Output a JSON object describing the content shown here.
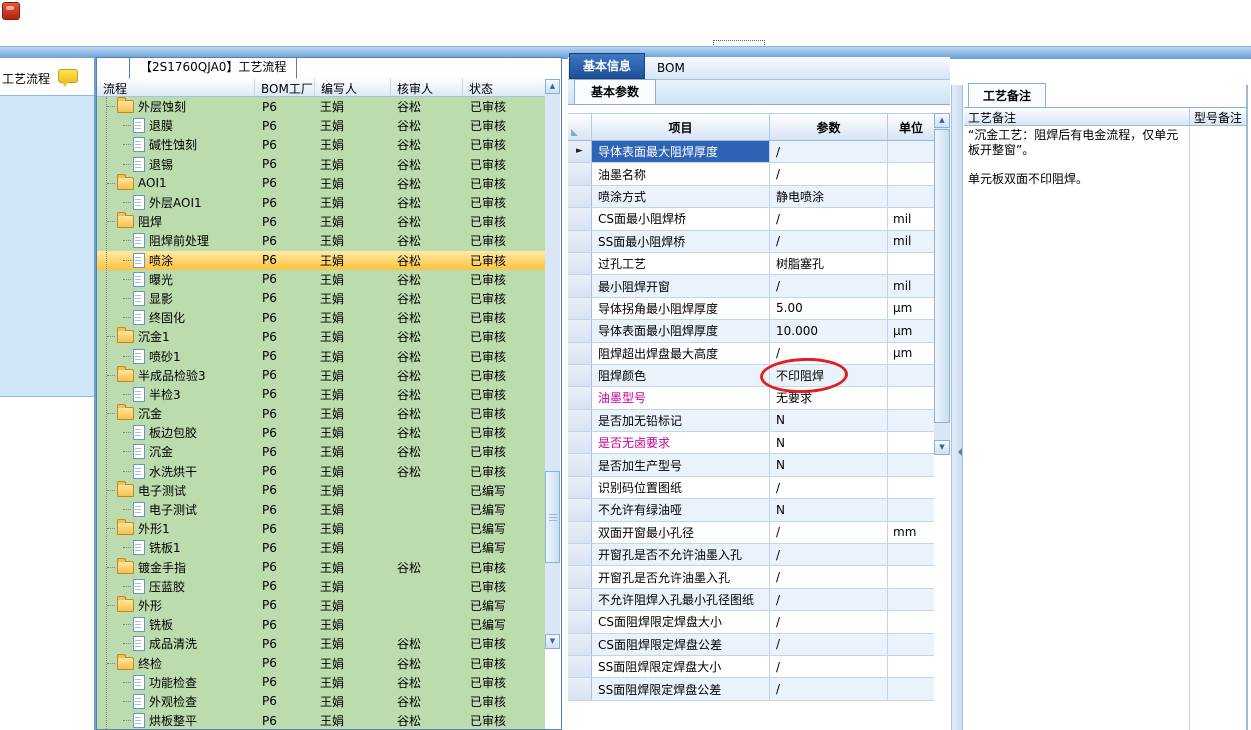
{
  "chrome": {
    "app_icon": "red-app-icon",
    "focus_marker": "dotted-focus-rect"
  },
  "left_panel": {
    "title": "工艺流程"
  },
  "process_window": {
    "title": "【2S1760QJA0】工艺流程",
    "columns": {
      "name": "流程",
      "factory": "BOM工厂",
      "writer": "编写人",
      "reviewer": "核审人",
      "status": "状态"
    },
    "rows": [
      {
        "name": "外层蚀刻",
        "type": "folder",
        "level": 1,
        "factory": "P6",
        "writer": "王娟",
        "reviewer": "谷松",
        "status": "已审核",
        "selected": false
      },
      {
        "name": "退膜",
        "type": "file",
        "level": 2,
        "factory": "P6",
        "writer": "王娟",
        "reviewer": "谷松",
        "status": "已审核",
        "selected": false
      },
      {
        "name": "碱性蚀刻",
        "type": "file",
        "level": 2,
        "factory": "P6",
        "writer": "王娟",
        "reviewer": "谷松",
        "status": "已审核",
        "selected": false
      },
      {
        "name": "退锡",
        "type": "file",
        "level": 2,
        "factory": "P6",
        "writer": "王娟",
        "reviewer": "谷松",
        "status": "已审核",
        "selected": false
      },
      {
        "name": "AOI1",
        "type": "folder",
        "level": 1,
        "factory": "P6",
        "writer": "王娟",
        "reviewer": "谷松",
        "status": "已审核",
        "selected": false
      },
      {
        "name": "外层AOI1",
        "type": "file",
        "level": 2,
        "factory": "P6",
        "writer": "王娟",
        "reviewer": "谷松",
        "status": "已审核",
        "selected": false
      },
      {
        "name": "阻焊",
        "type": "folder",
        "level": 1,
        "factory": "P6",
        "writer": "王娟",
        "reviewer": "谷松",
        "status": "已审核",
        "selected": false
      },
      {
        "name": "阻焊前处理",
        "type": "file",
        "level": 2,
        "factory": "P6",
        "writer": "王娟",
        "reviewer": "谷松",
        "status": "已审核",
        "selected": false
      },
      {
        "name": "喷涂",
        "type": "file",
        "level": 2,
        "factory": "P6",
        "writer": "王娟",
        "reviewer": "谷松",
        "status": "已审核",
        "selected": true
      },
      {
        "name": "曝光",
        "type": "file",
        "level": 2,
        "factory": "P6",
        "writer": "王娟",
        "reviewer": "谷松",
        "status": "已审核",
        "selected": false
      },
      {
        "name": "显影",
        "type": "file",
        "level": 2,
        "factory": "P6",
        "writer": "王娟",
        "reviewer": "谷松",
        "status": "已审核",
        "selected": false
      },
      {
        "name": "终固化",
        "type": "file",
        "level": 2,
        "factory": "P6",
        "writer": "王娟",
        "reviewer": "谷松",
        "status": "已审核",
        "selected": false
      },
      {
        "name": "沉金1",
        "type": "folder",
        "level": 1,
        "factory": "P6",
        "writer": "王娟",
        "reviewer": "谷松",
        "status": "已审核",
        "selected": false
      },
      {
        "name": "喷砂1",
        "type": "file",
        "level": 2,
        "factory": "P6",
        "writer": "王娟",
        "reviewer": "谷松",
        "status": "已审核",
        "selected": false
      },
      {
        "name": "半成品检验3",
        "type": "folder",
        "level": 1,
        "factory": "P6",
        "writer": "王娟",
        "reviewer": "谷松",
        "status": "已审核",
        "selected": false
      },
      {
        "name": "半检3",
        "type": "file",
        "level": 2,
        "factory": "P6",
        "writer": "王娟",
        "reviewer": "谷松",
        "status": "已审核",
        "selected": false
      },
      {
        "name": "沉金",
        "type": "folder",
        "level": 1,
        "factory": "P6",
        "writer": "王娟",
        "reviewer": "谷松",
        "status": "已审核",
        "selected": false
      },
      {
        "name": "板边包胶",
        "type": "file",
        "level": 2,
        "factory": "P6",
        "writer": "王娟",
        "reviewer": "谷松",
        "status": "已审核",
        "selected": false
      },
      {
        "name": "沉金",
        "type": "file",
        "level": 2,
        "factory": "P6",
        "writer": "王娟",
        "reviewer": "谷松",
        "status": "已审核",
        "selected": false
      },
      {
        "name": "水洗烘干",
        "type": "file",
        "level": 2,
        "factory": "P6",
        "writer": "王娟",
        "reviewer": "谷松",
        "status": "已审核",
        "selected": false
      },
      {
        "name": "电子测试",
        "type": "folder",
        "level": 1,
        "factory": "P6",
        "writer": "王娟",
        "reviewer": "",
        "status": "已编写",
        "selected": false
      },
      {
        "name": "电子测试",
        "type": "file",
        "level": 2,
        "factory": "P6",
        "writer": "王娟",
        "reviewer": "",
        "status": "已编写",
        "selected": false
      },
      {
        "name": "外形1",
        "type": "folder",
        "level": 1,
        "factory": "P6",
        "writer": "王娟",
        "reviewer": "",
        "status": "已编写",
        "selected": false
      },
      {
        "name": "铣板1",
        "type": "file",
        "level": 2,
        "factory": "P6",
        "writer": "王娟",
        "reviewer": "",
        "status": "已编写",
        "selected": false
      },
      {
        "name": "镀金手指",
        "type": "folder",
        "level": 1,
        "factory": "P6",
        "writer": "王娟",
        "reviewer": "谷松",
        "status": "已审核",
        "selected": false
      },
      {
        "name": "压蓝胶",
        "type": "file",
        "level": 2,
        "factory": "P6",
        "writer": "王娟",
        "reviewer": "",
        "status": "已审核",
        "selected": false
      },
      {
        "name": "外形",
        "type": "folder",
        "level": 1,
        "factory": "P6",
        "writer": "王娟",
        "reviewer": "",
        "status": "已编写",
        "selected": false
      },
      {
        "name": "铣板",
        "type": "file",
        "level": 2,
        "factory": "P6",
        "writer": "王娟",
        "reviewer": "",
        "status": "已编写",
        "selected": false
      },
      {
        "name": "成品清洗",
        "type": "file",
        "level": 2,
        "factory": "P6",
        "writer": "王娟",
        "reviewer": "谷松",
        "status": "已审核",
        "selected": false
      },
      {
        "name": "终检",
        "type": "folder",
        "level": 1,
        "factory": "P6",
        "writer": "王娟",
        "reviewer": "谷松",
        "status": "已审核",
        "selected": false
      },
      {
        "name": "功能检查",
        "type": "file",
        "level": 2,
        "factory": "P6",
        "writer": "王娟",
        "reviewer": "谷松",
        "status": "已审核",
        "selected": false
      },
      {
        "name": "外观检查",
        "type": "file",
        "level": 2,
        "factory": "P6",
        "writer": "王娟",
        "reviewer": "谷松",
        "status": "已审核",
        "selected": false
      },
      {
        "name": "烘板整平",
        "type": "file",
        "level": 2,
        "factory": "P6",
        "writer": "王娟",
        "reviewer": "谷松",
        "status": "已审核",
        "selected": false
      }
    ]
  },
  "detail_window": {
    "tabs": {
      "info": "基本信息",
      "bom": "BOM"
    },
    "subtab": "基本参数",
    "grid": {
      "columns": {
        "item": "项目",
        "value": "参数",
        "unit": "单位"
      },
      "rows": [
        {
          "item": "导体表面最大阻焊厚度",
          "value": "/",
          "unit": "",
          "current": true,
          "magenta": false,
          "annotated": false
        },
        {
          "item": "油墨名称",
          "value": "/",
          "unit": "",
          "current": false,
          "magenta": false,
          "annotated": false
        },
        {
          "item": "喷涂方式",
          "value": "静电喷涂",
          "unit": "",
          "current": false,
          "magenta": false,
          "annotated": false
        },
        {
          "item": "CS面最小阻焊桥",
          "value": "/",
          "unit": "mil",
          "current": false,
          "magenta": false,
          "annotated": false
        },
        {
          "item": "SS面最小阻焊桥",
          "value": "/",
          "unit": "mil",
          "current": false,
          "magenta": false,
          "annotated": false
        },
        {
          "item": "过孔工艺",
          "value": "树脂塞孔",
          "unit": "",
          "current": false,
          "magenta": false,
          "annotated": false
        },
        {
          "item": "最小阻焊开窗",
          "value": "/",
          "unit": "mil",
          "current": false,
          "magenta": false,
          "annotated": false
        },
        {
          "item": "导体拐角最小阻焊厚度",
          "value": "5.00",
          "unit": "μm",
          "current": false,
          "magenta": false,
          "annotated": false
        },
        {
          "item": "导体表面最小阻焊厚度",
          "value": "10.000",
          "unit": "μm",
          "current": false,
          "magenta": false,
          "annotated": false
        },
        {
          "item": "阻焊超出焊盘最大高度",
          "value": "/",
          "unit": "μm",
          "current": false,
          "magenta": false,
          "annotated": false
        },
        {
          "item": "阻焊颜色",
          "value": "不印阻焊",
          "unit": "",
          "current": false,
          "magenta": false,
          "annotated": true
        },
        {
          "item": "油墨型号",
          "value": "无要求",
          "unit": "",
          "current": false,
          "magenta": true,
          "annotated": false
        },
        {
          "item": "是否加无铅标记",
          "value": "N",
          "unit": "",
          "current": false,
          "magenta": false,
          "annotated": false
        },
        {
          "item": "是否无卤要求",
          "value": "N",
          "unit": "",
          "current": false,
          "magenta": true,
          "annotated": false
        },
        {
          "item": "是否加生产型号",
          "value": "N",
          "unit": "",
          "current": false,
          "magenta": false,
          "annotated": false
        },
        {
          "item": "识别码位置图纸",
          "value": "/",
          "unit": "",
          "current": false,
          "magenta": false,
          "annotated": false
        },
        {
          "item": "不允许有绿油哑",
          "value": "N",
          "unit": "",
          "current": false,
          "magenta": false,
          "annotated": false
        },
        {
          "item": "双面开窗最小孔径",
          "value": "/",
          "unit": "mm",
          "current": false,
          "magenta": false,
          "annotated": false
        },
        {
          "item": "开窗孔是否不允许油墨入孔",
          "value": "/",
          "unit": "",
          "current": false,
          "magenta": false,
          "annotated": false
        },
        {
          "item": "开窗孔是否允许油墨入孔",
          "value": "/",
          "unit": "",
          "current": false,
          "magenta": false,
          "annotated": false
        },
        {
          "item": "不允许阻焊入孔最小孔径图纸",
          "value": "/",
          "unit": "",
          "current": false,
          "magenta": false,
          "annotated": false
        },
        {
          "item": "CS面阻焊限定焊盘大小",
          "value": "/",
          "unit": "",
          "current": false,
          "magenta": false,
          "annotated": false
        },
        {
          "item": "CS面阻焊限定焊盘公差",
          "value": "/",
          "unit": "",
          "current": false,
          "magenta": false,
          "annotated": false
        },
        {
          "item": "SS面阻焊限定焊盘大小",
          "value": "/",
          "unit": "",
          "current": false,
          "magenta": false,
          "annotated": false
        },
        {
          "item": "SS面阻焊限定焊盘公差",
          "value": "/",
          "unit": "",
          "current": false,
          "magenta": false,
          "annotated": false
        }
      ]
    }
  },
  "notes_panel": {
    "tab": "工艺备注",
    "columns": {
      "process": "工艺备注",
      "model": "型号备注"
    },
    "notes": [
      "“沉金工艺：阻焊后有电金流程，仅单元板开整窗”。",
      "单元板双面不印阻焊。"
    ]
  },
  "colors": {
    "accent_blue": "#2b64ad",
    "tree_green": "#bcdcae",
    "selected_yellow": "#fbc43e",
    "magenta_label": "#cc0099",
    "annotation_red": "#e02020",
    "selected_cell_blue": "#2f63b5"
  }
}
